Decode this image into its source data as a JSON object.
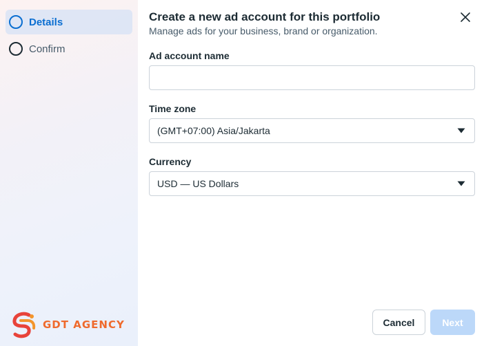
{
  "steps": [
    {
      "label": "Details",
      "active": true
    },
    {
      "label": "Confirm",
      "active": false
    }
  ],
  "branding": {
    "logo_text": "GDT AGENCY",
    "logo_mark": "gdt-logo-mark"
  },
  "dialog": {
    "title": "Create a new ad account for this portfolio",
    "subtitle": "Manage ads for your business, brand or organization.",
    "close_icon": "close-icon"
  },
  "form": {
    "ad_account_name": {
      "label": "Ad account name",
      "value": "",
      "placeholder": ""
    },
    "time_zone": {
      "label": "Time zone",
      "value": "(GMT+07:00) Asia/Jakarta"
    },
    "currency": {
      "label": "Currency",
      "value": "USD — US Dollars"
    }
  },
  "footer": {
    "cancel_label": "Cancel",
    "next_label": "Next"
  },
  "colors": {
    "accent": "#0a6ed1",
    "next_disabled": "#bcd8f9",
    "brand_orange": "#ef6a2d",
    "brand_red": "#e8433a"
  }
}
